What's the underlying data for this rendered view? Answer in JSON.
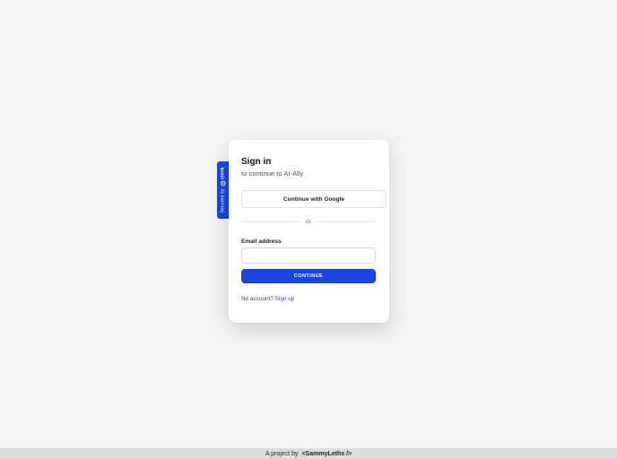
{
  "secured_tab": {
    "label": "Secured by",
    "brand": "clerk",
    "color": "#1a44e0",
    "icon": "clerk-logo-icon"
  },
  "card": {
    "title": "Sign in",
    "subtitle": "to continue to AI-Ally",
    "google_button_label": "Continue with Google",
    "divider_text": "or",
    "email_label": "Email address",
    "email_value": "",
    "email_placeholder": "",
    "continue_label": "CONTINUE",
    "no_account_text": "No account?",
    "signup_label": "Sign up"
  },
  "footer": {
    "prefix": "A project by",
    "author": "<SammyLeths />"
  },
  "colors": {
    "accent": "#1a44e0",
    "background": "#f4f4f4",
    "footer_bar": "#dcdcdc"
  }
}
